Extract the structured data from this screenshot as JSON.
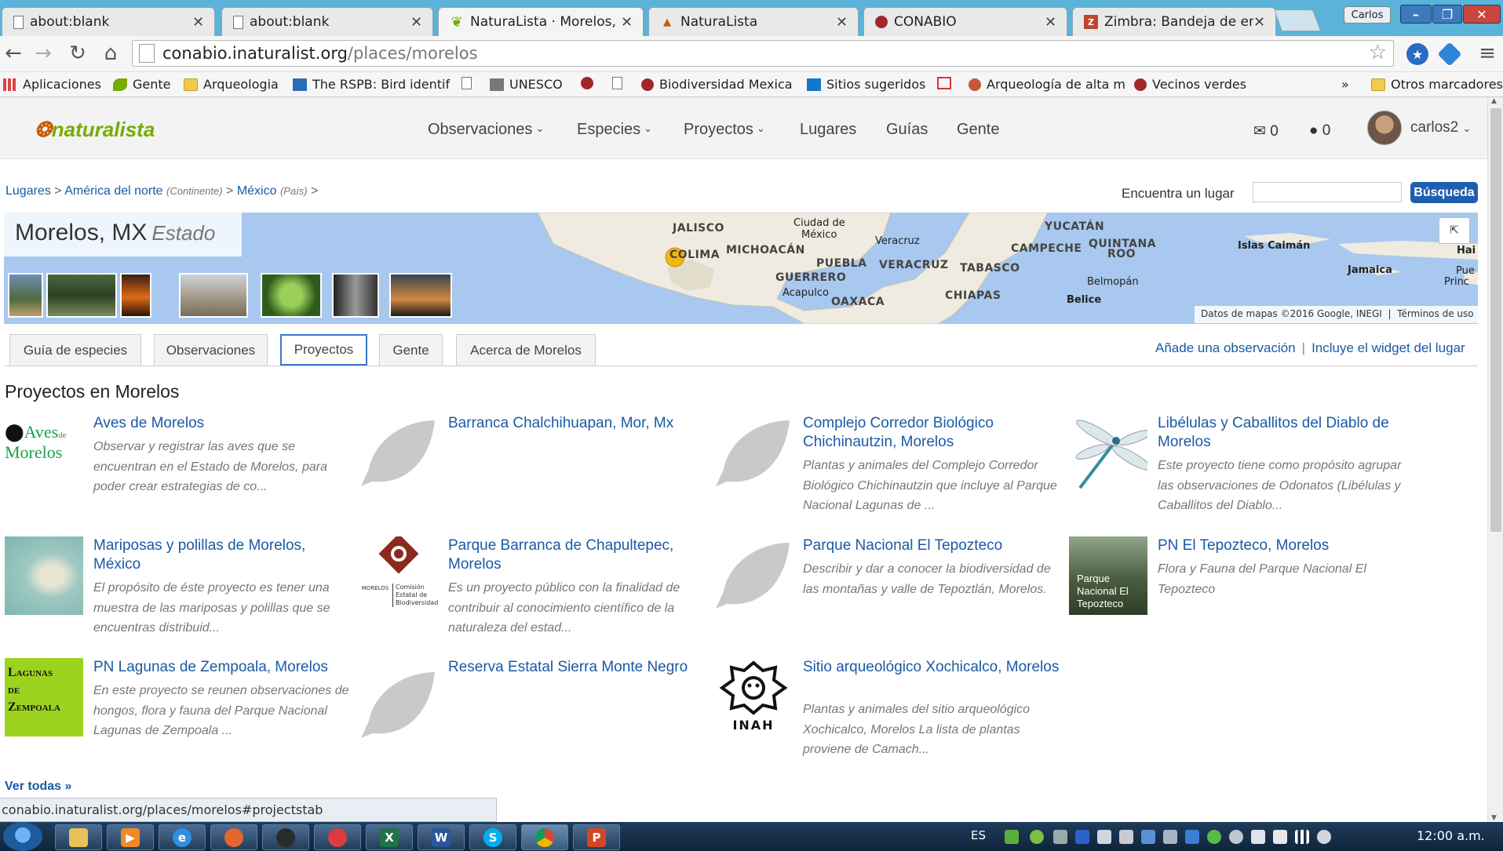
{
  "browser": {
    "tabs": [
      {
        "title": "about:blank",
        "active": false
      },
      {
        "title": "about:blank",
        "active": false
      },
      {
        "title": "NaturaLista · Morelos, MX",
        "active": true
      },
      {
        "title": "NaturaLista",
        "active": false
      },
      {
        "title": "CONABIO",
        "active": false
      },
      {
        "title": "Zimbra: Bandeja de entrad",
        "active": false
      }
    ],
    "profile_name": "Carlos",
    "url_host": "conabio.inaturalist.org",
    "url_path": "/places/morelos",
    "bookmarks": [
      "Aplicaciones",
      "Gente",
      "Arqueologia",
      "The RSPB: Bird identif",
      "",
      "UNESCO",
      "",
      "",
      "Biodiversidad Mexica",
      "Sitios sugeridos",
      "",
      "Arqueología de alta m",
      "Vecinos verdes"
    ],
    "bookmarks_overflow": "»",
    "other_bookmarks": "Otros marcadores",
    "status_url": "conabio.inaturalist.org/places/morelos#projectstab"
  },
  "site": {
    "logo": "naturalista",
    "nav": [
      "Observaciones",
      "Especies",
      "Proyectos",
      "Lugares",
      "Guías",
      "Gente"
    ],
    "messages_count": "0",
    "comments_count": "0",
    "username": "carlos2"
  },
  "breadcrumb": {
    "lugares": "Lugares",
    "sep": ">",
    "continent": "América del norte",
    "continent_type": "(Continente)",
    "country": "México",
    "country_type": "(País)"
  },
  "search": {
    "label": "Encuentra un lugar",
    "button": "Búsqueda",
    "value": ""
  },
  "place": {
    "name": "Morelos, MX",
    "type": "Estado"
  },
  "map": {
    "labels": [
      "JALISCO",
      "Ciudad de",
      "México",
      "Veracruz",
      "YUCATÁN",
      "COLIMA",
      "MICHOACÁN",
      "CAMPECHE",
      "QUINTANA",
      "ROO",
      "Islas Caimán",
      "Hai",
      "PUEBLA",
      "VERACRUZ",
      "TABASCO",
      "GUERRERO",
      "Belmopán",
      "Acapulco",
      "CHIAPAS",
      "OAXACA",
      "Belice",
      "Jamaica",
      "Pue",
      "Princ"
    ],
    "credit": "Datos de mapas ©2016 Google, INEGI",
    "terms": "Términos de uso"
  },
  "tabs": {
    "items": [
      "Guía de especies",
      "Observaciones",
      "Proyectos",
      "Gente",
      "Acerca de Morelos"
    ],
    "active": "Proyectos",
    "add_observation": "Añade una observación",
    "separator": "|",
    "widget": "Incluye el widget del lugar"
  },
  "projects": {
    "heading": "Proyectos en Morelos",
    "items": [
      {
        "title": "Aves de Morelos",
        "description": "Observar y registrar las aves que se encuentran en el Estado de Morelos, para poder crear estrategias de co...",
        "image": "aves-logo"
      },
      {
        "title": "Barranca Chalchihuapan, Mor, Mx",
        "description": "",
        "image": "leaf-placeholder"
      },
      {
        "title": "Complejo Corredor Biológico Chichinautzin, Morelos",
        "description": "Plantas y animales del Complejo Corredor Biológico Chichinautzin que incluye al Parque Nacional Lagunas de ...",
        "image": "leaf-placeholder"
      },
      {
        "title": "Libélulas y Caballitos del Diablo de Morelos",
        "description": "Este proyecto tiene como propósito agrupar las observaciones de Odonatos (Libélulas y Caballitos del Diablo...",
        "image": "dragonfly"
      },
      {
        "title": "Mariposas y polillas de Morelos, México",
        "description": "El propósito de éste proyecto es tener una muestra de las mariposas y polillas que se encuentras distribuid...",
        "image": "moth-photo"
      },
      {
        "title": "Parque Barranca de Chapultepec, Morelos",
        "description": "Es un proyecto público con la finalidad de contribuir al conocimiento científico de la naturaleza del estad...",
        "image": "comision-logo"
      },
      {
        "title": "Parque Nacional El Tepozteco",
        "description": "Describir y dar a conocer la biodiversidad de las montañas y valle de Tepoztlán, Morelos.",
        "image": "leaf-placeholder"
      },
      {
        "title": "PN El Tepozteco, Morelos",
        "description": "Flora y Fauna del Parque Nacional El Tepozteco",
        "image": "tepozteco-photo"
      },
      {
        "title": "PN Lagunas de Zempoala, Morelos",
        "description": "En este proyecto se reunen observaciones de hongos, flora y fauna del Parque Nacional Lagunas de Zempoala ...",
        "image": "lagunas-logo"
      },
      {
        "title": "Reserva Estatal Sierra Monte Negro",
        "description": "",
        "image": "leaf-placeholder"
      },
      {
        "title": "Sitio arqueológico Xochicalco, Morelos",
        "description": "Plantas y animales del sitio arqueológico Xochicalco, Morelos La lista de plantas proviene de Camach...",
        "image": "inah-logo"
      }
    ],
    "image_texts": {
      "aves_line1": "Aves",
      "aves_de": "de",
      "aves_line2": "Morelos",
      "comision_caption_1": "Comisión",
      "comision_caption_2": "Estatal de",
      "comision_caption_3": "Biodiversidad",
      "comision_left": "MORELOS",
      "tepozteco_caption": "Parque Nacional El Tepozteco",
      "lagunas_1": "Lagunas",
      "lagunas_2": "de",
      "lagunas_3": "Zempoala",
      "inah": "INAH"
    },
    "view_all": "Ver todas »"
  },
  "taskbar": {
    "language": "ES",
    "clock": "12:00 a.m."
  },
  "colors": {
    "tabstrip": "#5bb3d9",
    "link": "#1a5aa6",
    "button": "#1f5eb0",
    "logo_green": "#74ac00",
    "leaf_gray": "#c9c9c9"
  }
}
